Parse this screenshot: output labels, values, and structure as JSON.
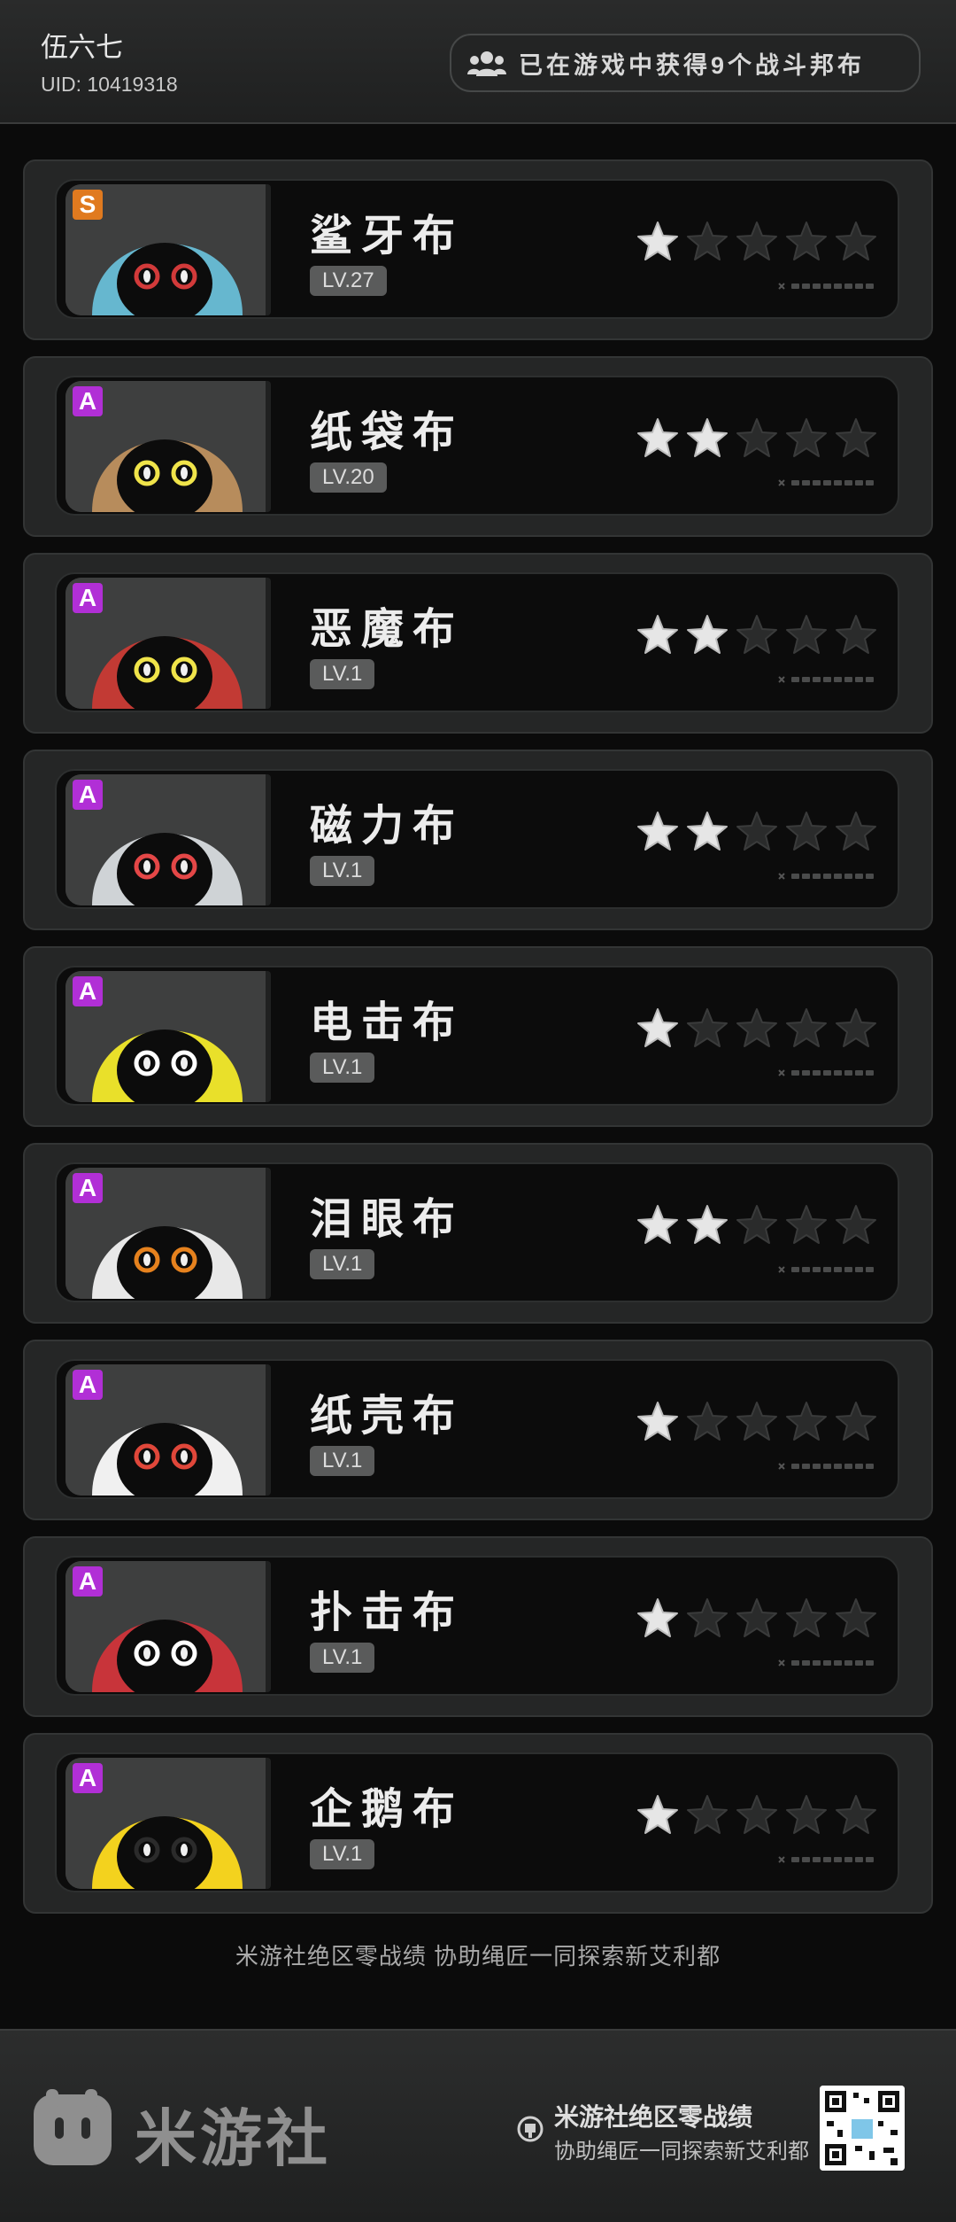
{
  "header": {
    "user_name": "伍六七",
    "uid": "UID: 10419318",
    "badge_text": "已在游戏中获得9个战斗邦布"
  },
  "cards": [
    {
      "name": "鲨牙布",
      "level": "LV.27",
      "rank": "S",
      "stars": 1,
      "bg": "#66b7cf",
      "accent": "#d23a3a",
      "icon": "shark-bangboo"
    },
    {
      "name": "纸袋布",
      "level": "LV.20",
      "rank": "A",
      "stars": 2,
      "bg": "#b78c5c",
      "accent": "#f0e44a",
      "icon": "paperbag-bangboo"
    },
    {
      "name": "恶魔布",
      "level": "LV.1",
      "rank": "A",
      "stars": 2,
      "bg": "#c23a34",
      "accent": "#f0e44a",
      "icon": "devil-bangboo"
    },
    {
      "name": "磁力布",
      "level": "LV.1",
      "rank": "A",
      "stars": 2,
      "bg": "#cfd3d6",
      "accent": "#e44747",
      "icon": "magnet-bangboo"
    },
    {
      "name": "电击布",
      "level": "LV.1",
      "rank": "A",
      "stars": 1,
      "bg": "#e9e02a",
      "accent": "#ffffff",
      "icon": "electric-bangboo"
    },
    {
      "name": "泪眼布",
      "level": "LV.1",
      "rank": "A",
      "stars": 2,
      "bg": "#e8e8e8",
      "accent": "#e6821e",
      "icon": "teary-bangboo"
    },
    {
      "name": "纸壳布",
      "level": "LV.1",
      "rank": "A",
      "stars": 1,
      "bg": "#f0f0f0",
      "accent": "#e0473a",
      "icon": "cardboard-bangboo"
    },
    {
      "name": "扑击布",
      "level": "LV.1",
      "rank": "A",
      "stars": 1,
      "bg": "#c8343a",
      "accent": "#ffffff",
      "icon": "boxer-bangboo"
    },
    {
      "name": "企鹅布",
      "level": "LV.1",
      "rank": "A",
      "stars": 1,
      "bg": "#f3d21e",
      "accent": "#2b2b2b",
      "icon": "penguin-bangboo"
    }
  ],
  "footer": {
    "slogan": "米游社绝区零战绩 协助绳匠一同探索新艾利都",
    "logo_text": "米游社",
    "title": "米游社绝区零战绩",
    "subtitle": "协助绳匠一同探索新艾利都"
  },
  "colors": {
    "star_on": "#e6e6e6",
    "star_off": "#2a2b2b",
    "rank_s": "#e07a1f",
    "rank_a": "#b12fd6"
  }
}
